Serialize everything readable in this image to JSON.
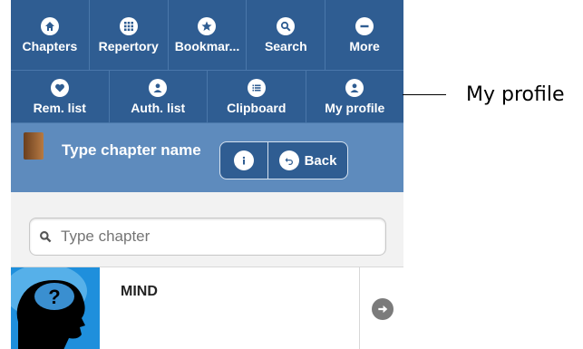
{
  "nav": {
    "row1": [
      {
        "label": "Chapters",
        "icon": "home-icon"
      },
      {
        "label": "Repertory",
        "icon": "grid-icon"
      },
      {
        "label": "Bookmar...",
        "icon": "star-icon"
      },
      {
        "label": "Search",
        "icon": "search-icon"
      },
      {
        "label": "More",
        "icon": "minus-icon"
      }
    ],
    "row2": [
      {
        "label": "Rem. list",
        "icon": "heart-icon"
      },
      {
        "label": "Auth. list",
        "icon": "user-icon"
      },
      {
        "label": "Clipboard",
        "icon": "list-icon"
      },
      {
        "label": "My profile",
        "icon": "user-icon"
      }
    ]
  },
  "chapter_bar": {
    "title": "Type chapter name",
    "back_label": "Back"
  },
  "search": {
    "placeholder": "Type chapter"
  },
  "list": [
    {
      "title": "MIND"
    }
  ],
  "annotation": {
    "label": "My profile"
  },
  "colors": {
    "nav_bg": "#2f5d92",
    "chapter_bar_bg": "#5e8bbd",
    "thumb_bg": "#1f8fdc"
  }
}
